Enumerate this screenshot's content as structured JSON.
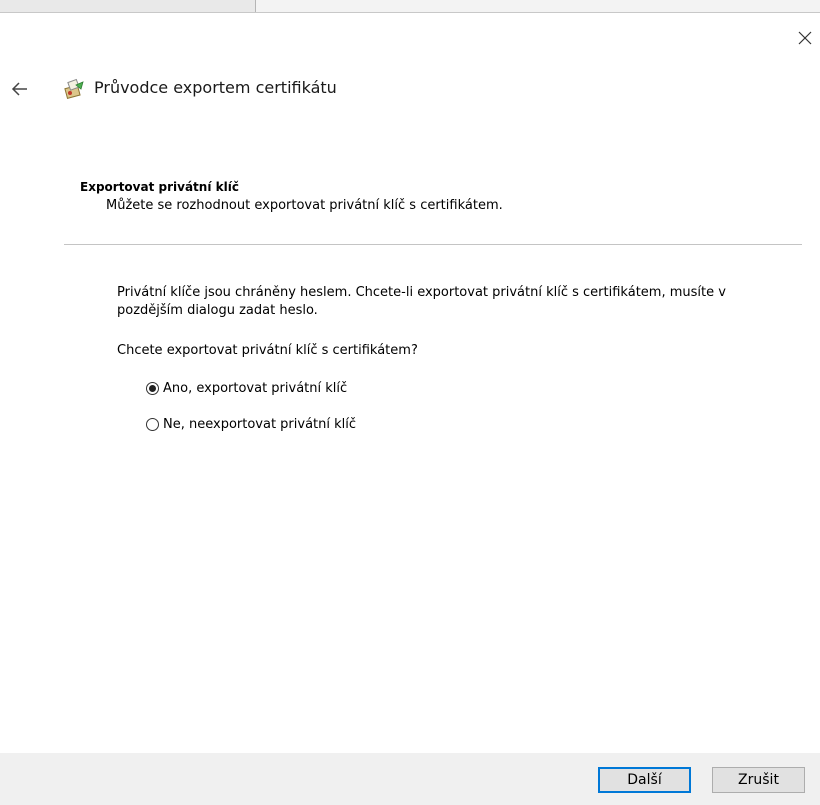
{
  "window": {
    "close_icon": "close-icon",
    "back_icon": "back-arrow-icon"
  },
  "wizard": {
    "icon": "certificate-wizard-icon",
    "title": "Průvodce exportem certifikátu"
  },
  "section": {
    "title": "Exportovat privátní klíč",
    "description": "Můžete se rozhodnout exportovat privátní klíč s certifikátem."
  },
  "body": {
    "info": "Privátní klíče jsou chráněny heslem. Chcete-li exportovat privátní klíč s certifikátem, musíte v pozdějším dialogu zadat heslo.",
    "question": "Chcete exportovat privátní klíč s certifikátem?"
  },
  "options": [
    {
      "label": "Ano, exportovat privátní klíč",
      "checked": true
    },
    {
      "label": "Ne, neexportovat privátní klíč",
      "checked": false
    }
  ],
  "footer": {
    "next_label": "Další",
    "cancel_label": "Zrušit"
  },
  "colors": {
    "accent": "#0078d7",
    "footer_bg": "#f0f0f0"
  }
}
